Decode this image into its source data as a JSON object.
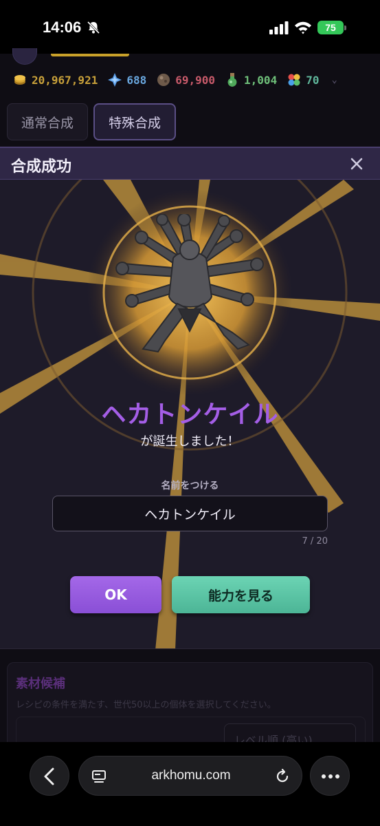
{
  "status_bar": {
    "time": "14:06",
    "battery": "75"
  },
  "resources": [
    {
      "icon": "coin-icon",
      "value": "20,967,921"
    },
    {
      "icon": "gem-icon",
      "value": "688"
    },
    {
      "icon": "ore-icon",
      "value": "69,900"
    },
    {
      "icon": "potion-icon",
      "value": "1,004"
    },
    {
      "icon": "clover-icon",
      "value": "70"
    }
  ],
  "tabs": [
    {
      "label": "通常合成"
    },
    {
      "label": "特殊合成"
    }
  ],
  "modal": {
    "title": "合成成功",
    "creature_name": "ヘカトンケイル",
    "born_text": "が誕生しました！",
    "name_label": "名前をつける",
    "name_value": "ヘカトンケイル",
    "char_count": "7 / 20",
    "ok_label": "OK",
    "ability_label": "能力を見る"
  },
  "material": {
    "title": "素材候補",
    "description": "レシピの条件を満たす、世代50以上の個体を選択してください。",
    "sort_value": "レベル順 (高い)"
  },
  "browser": {
    "url": "arkhomu.com"
  },
  "colors": {
    "accent_purple": "#a45ee6",
    "accent_teal": "#5cc6a6",
    "gold": "#d7a43c",
    "modal_header": "#2f2746"
  }
}
